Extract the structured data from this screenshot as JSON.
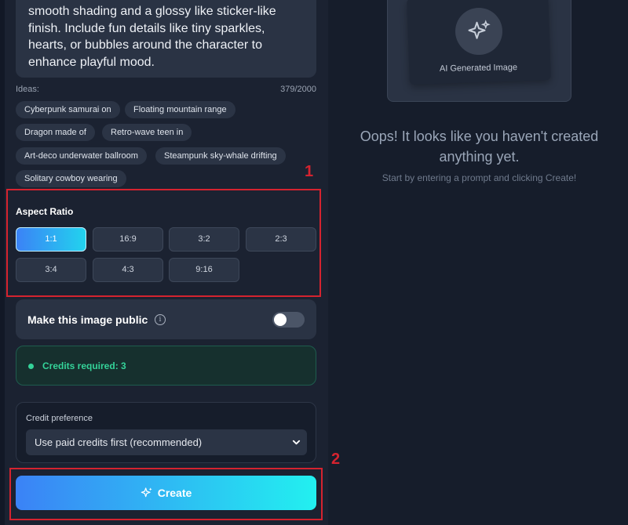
{
  "prompt": {
    "text": "smooth shading and a glossy like sticker-like finish. Include fun details like tiny sparkles, hearts, or bubbles around the character to enhance playful mood."
  },
  "ideas": {
    "label": "Ideas:",
    "count": "379/2000",
    "chips": [
      "Cyberpunk samurai on",
      "Floating mountain range",
      "Dragon made of",
      "Retro-wave teen in",
      "Art-deco underwater ballroom",
      "Steampunk sky-whale drifting",
      "Solitary cowboy wearing"
    ]
  },
  "aspect_ratio": {
    "title": "Aspect Ratio",
    "selected": "1:1",
    "options": [
      "1:1",
      "16:9",
      "3:2",
      "2:3",
      "3:4",
      "4:3",
      "9:16"
    ]
  },
  "public_toggle": {
    "label": "Make this image public",
    "info_icon": "info-icon",
    "enabled": false
  },
  "credits": {
    "text": "Credits required: 3",
    "color": "#34d399"
  },
  "credit_preference": {
    "label": "Credit preference",
    "selected": "Use paid credits first (recommended)"
  },
  "create_button": {
    "label": "Create",
    "icon": "sparkle-icon"
  },
  "preview": {
    "caption": "AI Generated Image",
    "icon": "sparkle-icon"
  },
  "empty_state": {
    "title": "Oops! It looks like you haven't created anything yet.",
    "subtitle": "Start by entering a prompt and clicking Create!"
  },
  "annotations": {
    "marker_1": "1",
    "marker_2": "2",
    "color": "#d5232f"
  }
}
